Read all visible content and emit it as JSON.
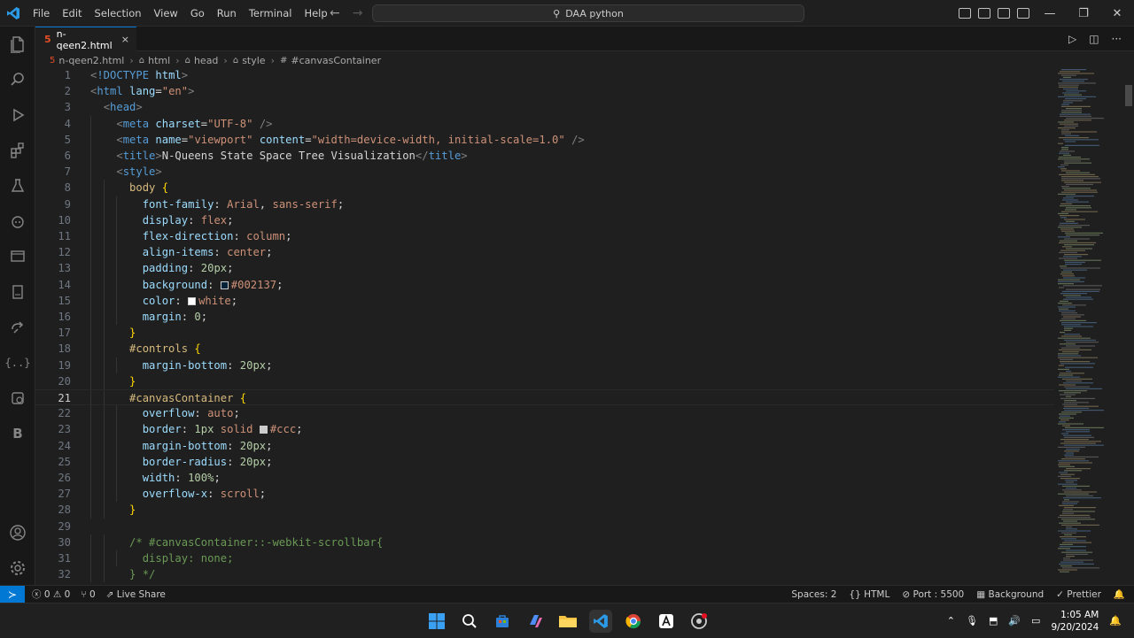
{
  "menu": [
    "File",
    "Edit",
    "Selection",
    "View",
    "Go",
    "Run",
    "Terminal",
    "Help"
  ],
  "search": {
    "label": "DAA python"
  },
  "tab": {
    "label": "n-qeen2.html",
    "close": "×"
  },
  "breadcrumbs": [
    "n-qeen2.html",
    "html",
    "head",
    "style",
    "#canvasContainer"
  ],
  "editor": {
    "current_line": 21,
    "lines": [
      {
        "n": "1",
        "code": "<!DOCTYPE html>"
      },
      {
        "n": "2",
        "code": "<html lang=\"en\">"
      },
      {
        "n": "3",
        "code": "  <head>"
      },
      {
        "n": "4",
        "code": "    <meta charset=\"UTF-8\" />"
      },
      {
        "n": "5",
        "code": "    <meta name=\"viewport\" content=\"width=device-width, initial-scale=1.0\" />"
      },
      {
        "n": "6",
        "code": "    <title>N-Queens State Space Tree Visualization</title>"
      },
      {
        "n": "7",
        "code": "    <style>"
      },
      {
        "n": "8",
        "code": "      body {"
      },
      {
        "n": "9",
        "code": "        font-family: Arial, sans-serif;"
      },
      {
        "n": "10",
        "code": "        display: flex;"
      },
      {
        "n": "11",
        "code": "        flex-direction: column;"
      },
      {
        "n": "12",
        "code": "        align-items: center;"
      },
      {
        "n": "13",
        "code": "        padding: 20px;"
      },
      {
        "n": "14",
        "code": "        background: #002137;"
      },
      {
        "n": "15",
        "code": "        color: white;"
      },
      {
        "n": "16",
        "code": "        margin: 0;"
      },
      {
        "n": "17",
        "code": "      }"
      },
      {
        "n": "18",
        "code": "      #controls {"
      },
      {
        "n": "19",
        "code": "        margin-bottom: 20px;"
      },
      {
        "n": "20",
        "code": "      }"
      },
      {
        "n": "21",
        "code": "      #canvasContainer {"
      },
      {
        "n": "22",
        "code": "        overflow: auto;"
      },
      {
        "n": "23",
        "code": "        border: 1px solid #ccc;"
      },
      {
        "n": "24",
        "code": "        margin-bottom: 20px;"
      },
      {
        "n": "25",
        "code": "        border-radius: 20px;"
      },
      {
        "n": "26",
        "code": "        width: 100%;"
      },
      {
        "n": "27",
        "code": "        overflow-x: scroll;"
      },
      {
        "n": "28",
        "code": "      }"
      },
      {
        "n": "29",
        "code": ""
      },
      {
        "n": "30",
        "code": "      /* #canvasContainer::-webkit-scrollbar{"
      },
      {
        "n": "31",
        "code": "        display: none;"
      },
      {
        "n": "32",
        "code": "      } */"
      }
    ]
  },
  "status": {
    "errors": "0",
    "warnings": "0",
    "ports": "0",
    "live_share": "Live Share",
    "spaces": "Spaces: 2",
    "language": "HTML",
    "port": "Port : 5500",
    "background": "Background",
    "prettier": "Prettier"
  },
  "clock": {
    "time": "1:05 AM",
    "date": "9/20/2024"
  },
  "colors": {
    "accent": "#0078d4",
    "bg": "#1f1f1f",
    "swatch_bg": "#002137",
    "swatch_white": "#ffffff",
    "swatch_ccc": "#cccccc"
  }
}
